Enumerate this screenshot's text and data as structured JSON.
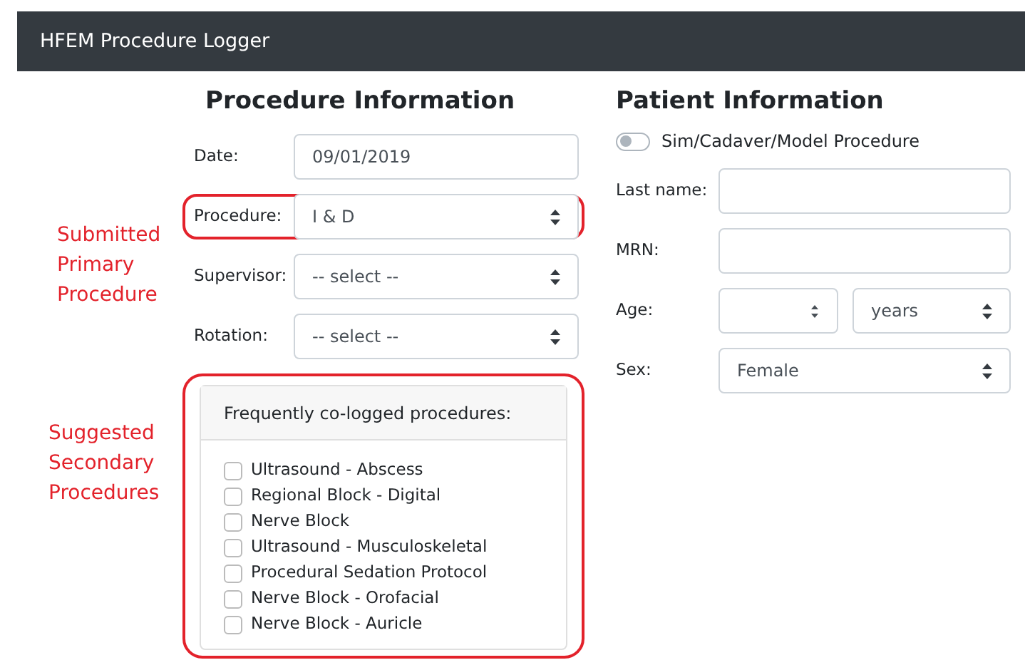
{
  "navbar": {
    "title": "HFEM Procedure Logger"
  },
  "procedure_information": {
    "title": "Procedure Information",
    "fields": [
      {
        "label": "Date:",
        "kind": "input",
        "value": "09/01/2019",
        "highlighted": false
      },
      {
        "label": "Procedure:",
        "kind": "select",
        "value": "I & D",
        "highlighted": true
      },
      {
        "label": "Supervisor:",
        "kind": "select",
        "value": "-- select --",
        "highlighted": false
      },
      {
        "label": "Rotation:",
        "kind": "select",
        "value": "-- select --",
        "highlighted": false
      }
    ],
    "suggestions": {
      "header": "Frequently co-logged procedures:",
      "highlighted": true,
      "items": [
        {
          "label": "Ultrasound - Abscess",
          "checked": false
        },
        {
          "label": "Regional Block - Digital",
          "checked": false
        },
        {
          "label": "Nerve Block",
          "checked": false
        },
        {
          "label": "Ultrasound - Musculoskeletal",
          "checked": false
        },
        {
          "label": "Procedural Sedation Protocol",
          "checked": false
        },
        {
          "label": "Nerve Block - Orofacial",
          "checked": false
        },
        {
          "label": "Nerve Block - Auricle",
          "checked": false
        }
      ]
    }
  },
  "annotations": [
    [
      "Submitted",
      "Primary",
      "Procedure"
    ],
    [
      "Suggested",
      "Secondary",
      "Procedures"
    ]
  ],
  "patient_information": {
    "title": "Patient Information",
    "toggle": {
      "label": "Sim/Cadaver/Model Procedure",
      "on": false
    },
    "fields": [
      {
        "label": "Last name:",
        "kind": "input"
      },
      {
        "label": "MRN:",
        "kind": "input"
      },
      {
        "label": "Age:",
        "kind": "age",
        "unit": "years"
      },
      {
        "label": "Sex:",
        "kind": "select",
        "value": "Female"
      }
    ]
  }
}
